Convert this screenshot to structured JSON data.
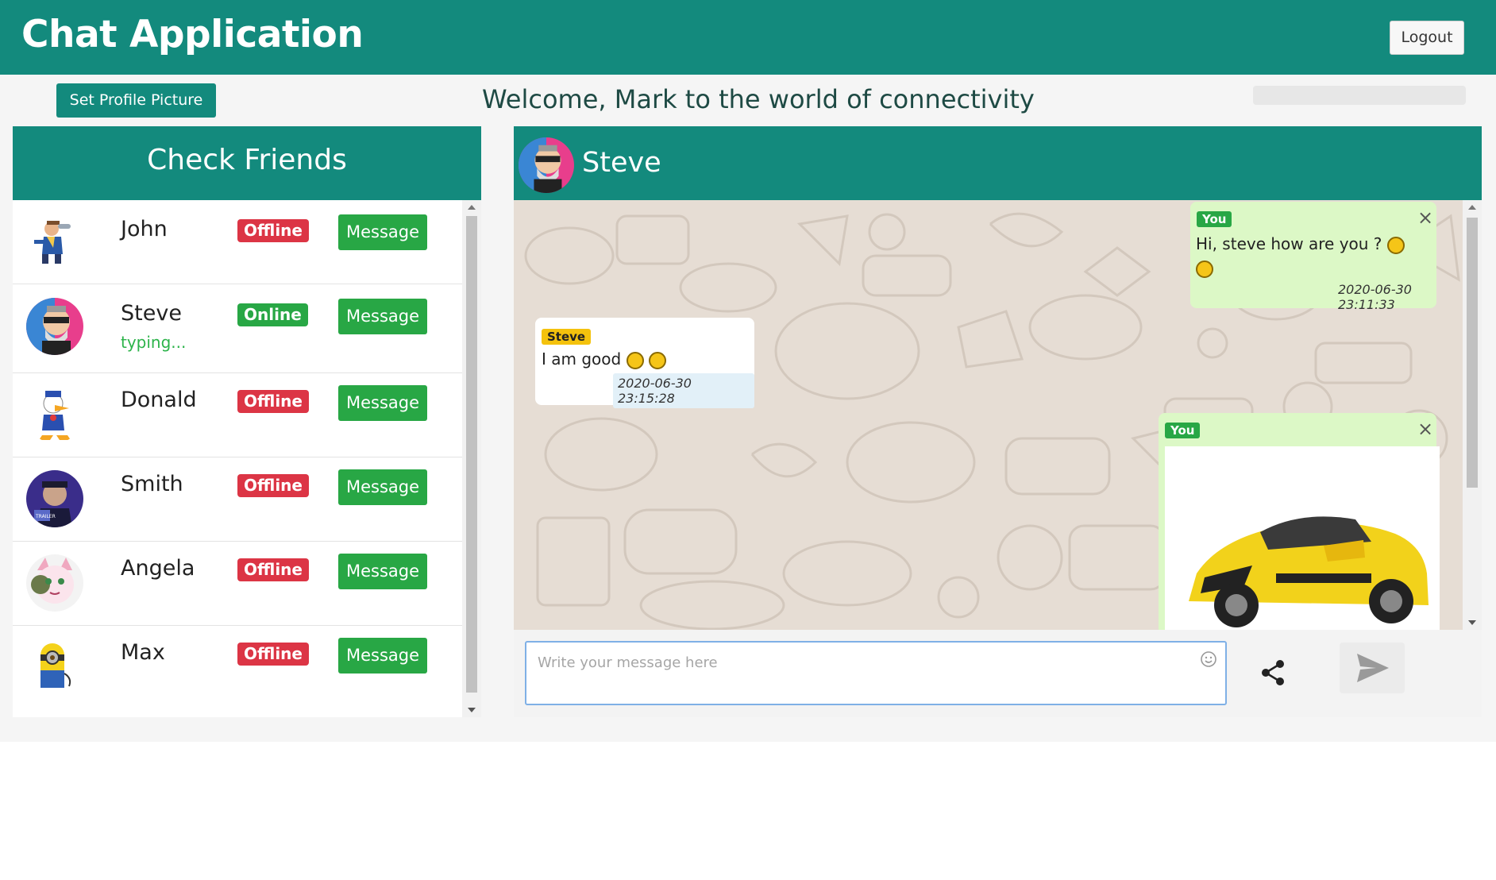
{
  "app": {
    "title": "Chat Application",
    "logout_label": "Logout"
  },
  "toolbar": {
    "set_profile_picture_label": "Set Profile Picture"
  },
  "welcome_text": "Welcome, Mark to the world of connectivity",
  "friends_panel": {
    "title": "Check Friends",
    "message_label": "Message",
    "items": [
      {
        "name": "John",
        "status": "Offline",
        "typing": ""
      },
      {
        "name": "Steve",
        "status": "Online",
        "typing": "typing..."
      },
      {
        "name": "Donald",
        "status": "Offline",
        "typing": ""
      },
      {
        "name": "Smith",
        "status": "Offline",
        "typing": ""
      },
      {
        "name": "Angela",
        "status": "Offline",
        "typing": ""
      },
      {
        "name": "Max",
        "status": "Offline",
        "typing": ""
      }
    ]
  },
  "chat": {
    "contact_name": "Steve",
    "messages": [
      {
        "sender": "You",
        "text": "Hi, steve how are you ?",
        "time": "2020-06-30 23:11:33"
      },
      {
        "sender": "Steve",
        "text": "I am good",
        "time": "2020-06-30 23:15:28"
      },
      {
        "sender": "You",
        "text": "",
        "time": ""
      }
    ],
    "close_symbol": "×",
    "composer_placeholder": "Write your message here"
  },
  "colors": {
    "primary": "#138a7d",
    "online": "#28a745",
    "offline": "#dc3545",
    "own_bubble": "#dcf8c6",
    "chat_background": "#e6ddd4"
  },
  "icons": {
    "logout": "none",
    "emoji": "smiley-icon",
    "share": "share-icon",
    "send": "send-icon"
  }
}
